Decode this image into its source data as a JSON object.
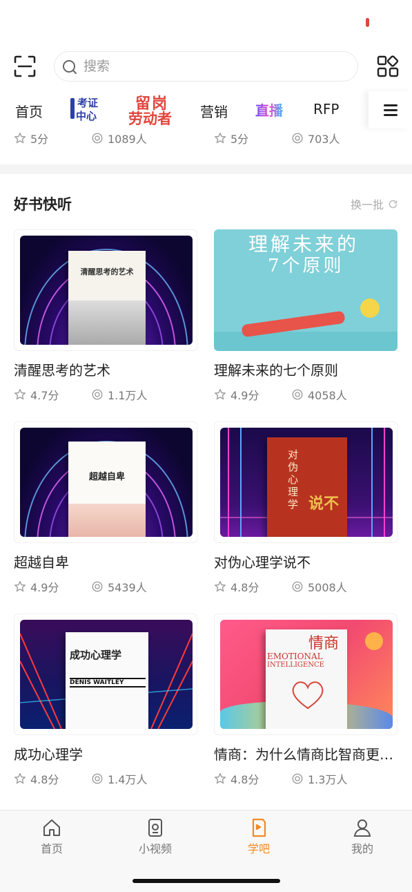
{
  "search": {
    "placeholder": "搜索"
  },
  "tabs": {
    "home": "首页",
    "cert_line1": "考证",
    "cert_line2": "中心",
    "labor_line1": "留岗",
    "labor_line2": "劳动者",
    "marketing": "营销",
    "live": "直播",
    "rfp": "RFP"
  },
  "prev_row": [
    {
      "rating": "5分",
      "views": "1089人"
    },
    {
      "rating": "5分",
      "views": "703人"
    }
  ],
  "section": {
    "title": "好书快听",
    "refresh_label": "换一批"
  },
  "books": [
    {
      "title": "清醒思考的艺术",
      "rating": "4.7分",
      "views": "1.1万人",
      "cover_text": "清醒思考的艺术"
    },
    {
      "title": "理解未来的七个原则",
      "rating": "4.9分",
      "views": "4058人",
      "cover_text_line1": "理解未来的",
      "cover_text_line2": "7个原则"
    },
    {
      "title": "超越自卑",
      "rating": "4.9分",
      "views": "5439人",
      "cover_text": "超越自卑"
    },
    {
      "title": "对伪心理学说不",
      "rating": "4.8分",
      "views": "5008人",
      "cover_text_line1": "对伪心理学",
      "cover_text_line2": "说不"
    },
    {
      "title": "成功心理学",
      "rating": "4.8分",
      "views": "1.4万人",
      "cover_text": "成功心理学",
      "cover_author": "DENIS WAITLEY"
    },
    {
      "title": "情商：为什么情商比智商更重要",
      "rating": "4.8分",
      "views": "1.3万人",
      "cover_text": "情商",
      "cover_en_line1": "EMOTIONAL",
      "cover_en_line2": "INTELLIGENCE"
    }
  ],
  "tabbar": [
    {
      "label": "首页",
      "icon": "home-icon",
      "active": false
    },
    {
      "label": "小视频",
      "icon": "video-icon",
      "active": false
    },
    {
      "label": "学吧",
      "icon": "book-icon",
      "active": true
    },
    {
      "label": "我的",
      "icon": "user-icon",
      "active": false
    }
  ],
  "colors": {
    "accent": "#f08a24",
    "labor_red": "#e0463c",
    "cert_blue": "#2d3fa8"
  }
}
